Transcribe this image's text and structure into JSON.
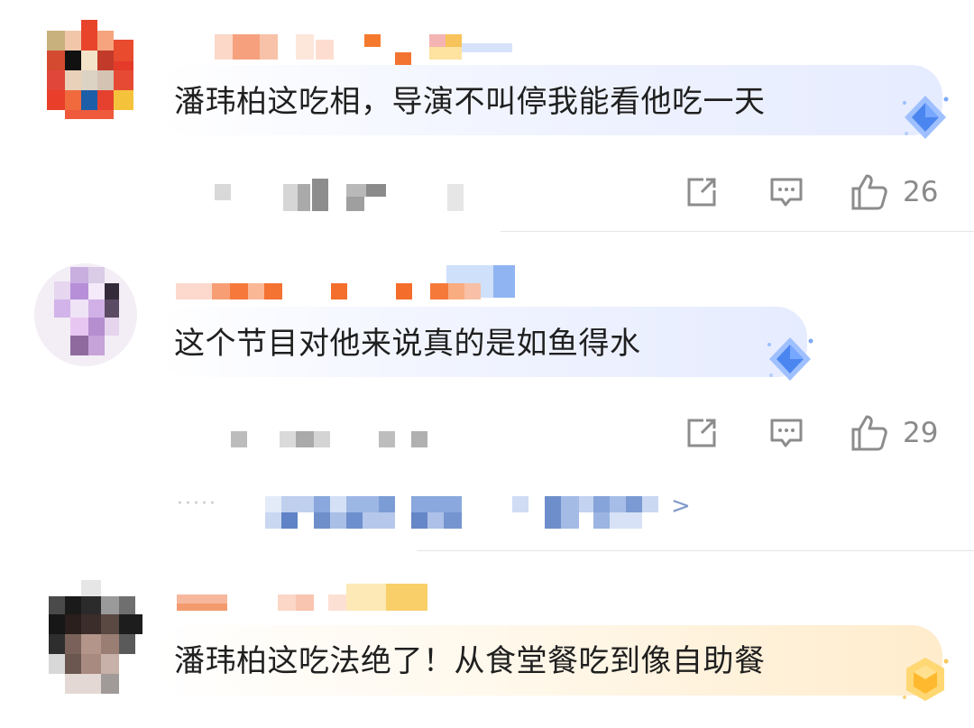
{
  "comments": [
    {
      "text": "潘玮柏这吃相，导演不叫停我能看他吃一天",
      "likes": "26",
      "badge": "blue"
    },
    {
      "text": "这个节目对他来说真的是如鱼得水",
      "likes": "29",
      "badge": "blue"
    },
    {
      "text": "潘玮柏这吃法绝了！从食堂餐吃到像自助餐",
      "badge": "gold"
    }
  ],
  "reply_link": {
    "chevron": ">"
  },
  "colors": {
    "icon_gray": "#8c8c8c",
    "link_blue": "#7f99c9",
    "divider": "#e5e5e5"
  },
  "icons": [
    "share-icon",
    "comment-icon",
    "like-icon",
    "diamond-badge-icon"
  ]
}
